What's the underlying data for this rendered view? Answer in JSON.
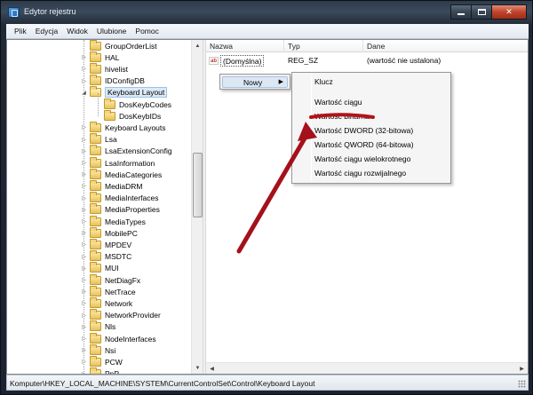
{
  "window": {
    "title": "Edytor rejestru",
    "icon": "regedit-icon",
    "close_glyph": "✕"
  },
  "menu": [
    "Plik",
    "Edycja",
    "Widok",
    "Ulubione",
    "Pomoc"
  ],
  "tree": {
    "items": [
      {
        "label": "GroupOrderList",
        "level": 0,
        "expander": "none",
        "icon": "folder-icon"
      },
      {
        "label": "HAL",
        "level": 0,
        "expander": "collapsed",
        "icon": "folder-icon"
      },
      {
        "label": "hivelist",
        "level": 0,
        "expander": "collapsed",
        "icon": "folder-icon"
      },
      {
        "label": "IDConfigDB",
        "level": 0,
        "expander": "collapsed",
        "icon": "folder-icon"
      },
      {
        "label": "Keyboard Layout",
        "level": 0,
        "expander": "expanded",
        "icon": "folder-open-icon",
        "selected": true
      },
      {
        "label": "DosKeybCodes",
        "level": 1,
        "expander": "none",
        "icon": "folder-icon"
      },
      {
        "label": "DosKeybIDs",
        "level": 1,
        "expander": "none",
        "icon": "folder-icon"
      },
      {
        "label": "Keyboard Layouts",
        "level": 0,
        "expander": "collapsed",
        "icon": "folder-icon"
      },
      {
        "label": "Lsa",
        "level": 0,
        "expander": "collapsed",
        "icon": "folder-icon"
      },
      {
        "label": "LsaExtensionConfig",
        "level": 0,
        "expander": "collapsed",
        "icon": "folder-icon"
      },
      {
        "label": "LsaInformation",
        "level": 0,
        "expander": "collapsed",
        "icon": "folder-icon"
      },
      {
        "label": "MediaCategories",
        "level": 0,
        "expander": "collapsed",
        "icon": "folder-icon"
      },
      {
        "label": "MediaDRM",
        "level": 0,
        "expander": "collapsed",
        "icon": "folder-icon"
      },
      {
        "label": "MediaInterfaces",
        "level": 0,
        "expander": "collapsed",
        "icon": "folder-icon"
      },
      {
        "label": "MediaProperties",
        "level": 0,
        "expander": "collapsed",
        "icon": "folder-icon"
      },
      {
        "label": "MediaTypes",
        "level": 0,
        "expander": "collapsed",
        "icon": "folder-icon"
      },
      {
        "label": "MobilePC",
        "level": 0,
        "expander": "collapsed",
        "icon": "folder-icon"
      },
      {
        "label": "MPDEV",
        "level": 0,
        "expander": "collapsed",
        "icon": "folder-icon"
      },
      {
        "label": "MSDTC",
        "level": 0,
        "expander": "collapsed",
        "icon": "folder-icon"
      },
      {
        "label": "MUI",
        "level": 0,
        "expander": "collapsed",
        "icon": "folder-icon"
      },
      {
        "label": "NetDiagFx",
        "level": 0,
        "expander": "collapsed",
        "icon": "folder-icon"
      },
      {
        "label": "NetTrace",
        "level": 0,
        "expander": "collapsed",
        "icon": "folder-icon"
      },
      {
        "label": "Network",
        "level": 0,
        "expander": "collapsed",
        "icon": "folder-icon"
      },
      {
        "label": "NetworkProvider",
        "level": 0,
        "expander": "collapsed",
        "icon": "folder-icon"
      },
      {
        "label": "Nls",
        "level": 0,
        "expander": "collapsed",
        "icon": "folder-icon"
      },
      {
        "label": "NodeInterfaces",
        "level": 0,
        "expander": "collapsed",
        "icon": "folder-icon"
      },
      {
        "label": "Nsi",
        "level": 0,
        "expander": "collapsed",
        "icon": "folder-icon"
      },
      {
        "label": "PCW",
        "level": 0,
        "expander": "collapsed",
        "icon": "folder-icon"
      },
      {
        "label": "PnP",
        "level": 0,
        "expander": "collapsed",
        "icon": "folder-icon"
      }
    ]
  },
  "list": {
    "columns": [
      "Nazwa",
      "Typ",
      "Dane"
    ],
    "rows": [
      {
        "name": "(Domyślna)",
        "type": "REG_SZ",
        "data": "(wartość nie ustalona)",
        "icon": "string-value-icon"
      }
    ]
  },
  "context_menu": {
    "item": "Nowy",
    "arrow": "▶",
    "submenu": [
      "Klucz",
      "Wartość ciągu",
      "Wartość binarna",
      "Wartość DWORD (32-bitowa)",
      "Wartość QWORD (64-bitowa)",
      "Wartość ciągu wielokrotnego",
      "Wartość ciągu rozwijalnego"
    ]
  },
  "status": {
    "path": "Komputer\\HKEY_LOCAL_MACHINE\\SYSTEM\\CurrentControlSet\\Control\\Keyboard Layout"
  },
  "colors": {
    "annotation_red": "#b3121a",
    "selection": "#dbe9f8",
    "menu_highlight": "#dce7f4"
  }
}
